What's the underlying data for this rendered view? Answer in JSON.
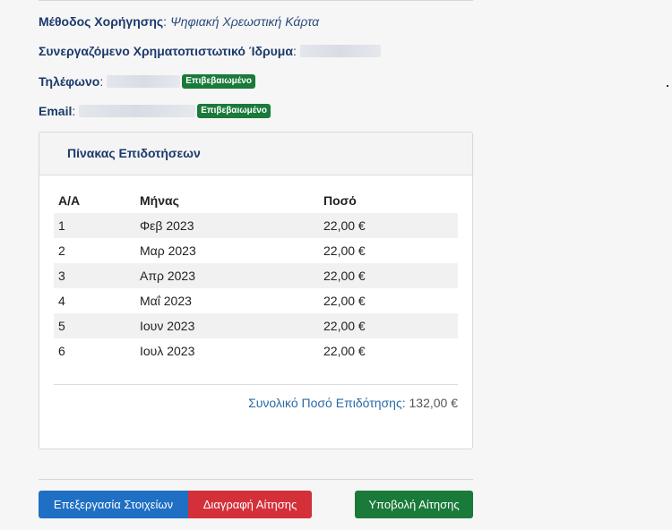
{
  "info": {
    "method_label": "Μέθοδος Χορήγησης",
    "method_value": "Ψηφιακή Χρεωστική Κάρτα",
    "bank_label": "Συνεργαζόμενο Χρηματοπιστωτικό Ίδρυμα",
    "phone_label": "Τηλέφωνο",
    "phone_badge": "Επιβεβαιωμένο",
    "email_label": "Email",
    "email_badge": "Επιβεβαιωμένο"
  },
  "panel": {
    "title": "Πίνακας Επιδοτήσεων",
    "headers": [
      "Α/Α",
      "Μήνας",
      "Ποσό"
    ],
    "rows": [
      [
        "1",
        "Φεβ 2023",
        "22,00 €"
      ],
      [
        "2",
        "Μαρ 2023",
        "22,00 €"
      ],
      [
        "3",
        "Απρ 2023",
        "22,00 €"
      ],
      [
        "4",
        "Μαΐ 2023",
        "22,00 €"
      ],
      [
        "5",
        "Ιουν 2023",
        "22,00 €"
      ],
      [
        "6",
        "Ιουλ 2023",
        "22,00 €"
      ]
    ],
    "total_label": "Συνολικό Ποσό Επιδότησης:",
    "total_value": "132,00 €"
  },
  "actions": {
    "edit_label": "Επεξεργασία Στοιχείων",
    "delete_label": "Διαγραφή Αίτησης",
    "submit_label": "Υποβολή Αίτησης"
  },
  "colors": {
    "primary": "#1f6fc4",
    "danger": "#d4303a",
    "success": "#1a7a3a",
    "heading": "#1b3a6b"
  }
}
